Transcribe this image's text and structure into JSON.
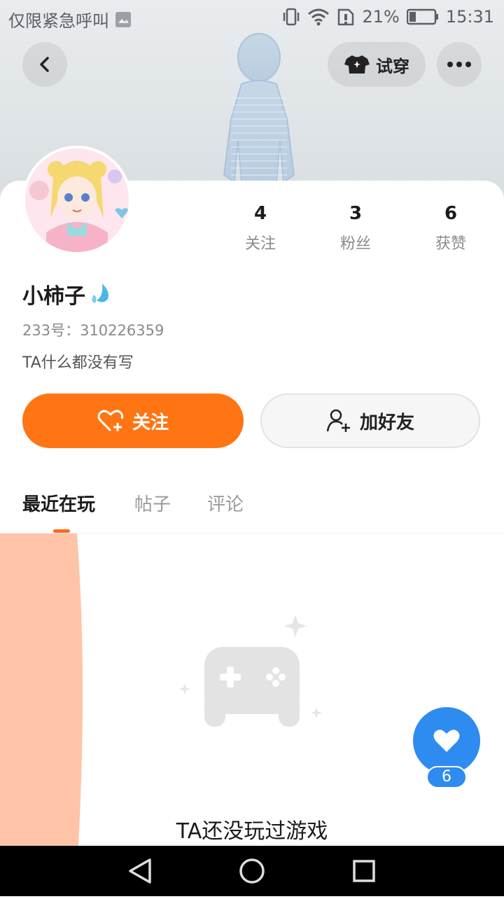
{
  "status_bar": {
    "carrier_text": "仅限紧急呼叫",
    "battery_percent": "21%",
    "time": "15:31"
  },
  "header": {
    "tryon_label": "试穿"
  },
  "profile": {
    "username": "小柿子",
    "uid": "233号：310226359",
    "bio": "TA什么都没有写",
    "stats": [
      {
        "value": "4",
        "label": "关注"
      },
      {
        "value": "3",
        "label": "粉丝"
      },
      {
        "value": "6",
        "label": "获赞"
      }
    ]
  },
  "actions": {
    "follow_label": "关注",
    "add_friend_label": "加好友"
  },
  "tabs": [
    {
      "label": "最近在玩",
      "active": true
    },
    {
      "label": "帖子",
      "active": false
    },
    {
      "label": "评论",
      "active": false
    }
  ],
  "empty_state": {
    "text": "TA还没玩过游戏"
  },
  "like_fab": {
    "count": "6"
  },
  "colors": {
    "accent_orange": "#ff7514",
    "fab_blue": "#2e8bf0",
    "side_peach": "#ffc4a8"
  }
}
